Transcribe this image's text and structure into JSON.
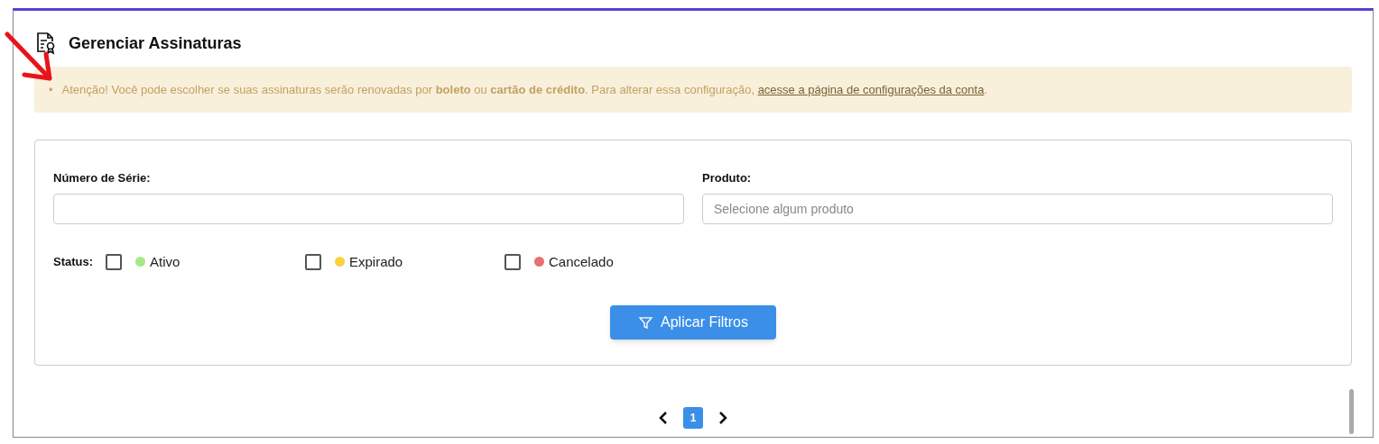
{
  "header": {
    "title": "Gerenciar Assinaturas"
  },
  "alert": {
    "bullet": "•",
    "text": "Atenção! Você pode escolher se suas assinaturas serão renovadas por **boleto** ou **cartão de crédito**. Para alterar essa configuração,",
    "link": "acesse a página de configurações da conta",
    "end": "."
  },
  "filters": {
    "serial": {
      "label": "Número de Série:"
    },
    "product": {
      "label": "Produto:",
      "placeholder": "Selecione algum produto"
    },
    "status_label": "Status:",
    "statuses": [
      {
        "label": "Ativo",
        "checked": false,
        "color": "#a8e88a"
      },
      {
        "label": "Expirado",
        "checked": false,
        "color": "#fdd13f"
      },
      {
        "label": "Cancelado",
        "checked": false,
        "color": "#e8706e"
      }
    ],
    "apply": "Aplicar Filtros"
  },
  "pagination": {
    "pages": [
      {
        "label": "1",
        "selected": true
      }
    ]
  }
}
